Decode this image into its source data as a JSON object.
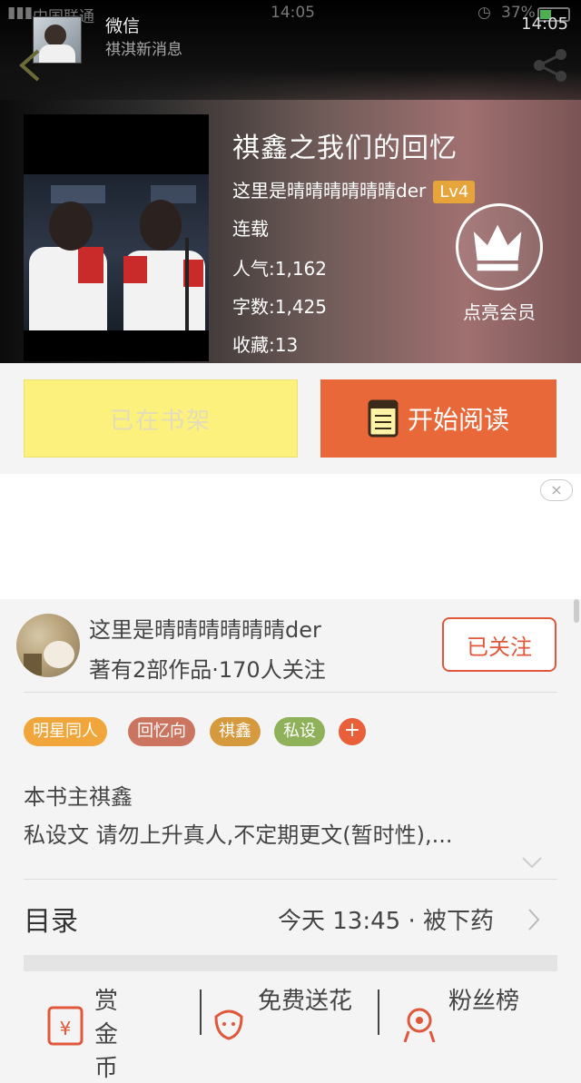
{
  "status_bar": {
    "carrier": "中国联通",
    "time": "14:05",
    "battery": "37%"
  },
  "notification": {
    "app": "微信",
    "message": "祺淇新消息",
    "time": "14:05"
  },
  "book": {
    "title": "祺鑫之我们的回忆",
    "author": "这里是晴晴晴晴晴晴der",
    "author_level": "Lv4",
    "status": "连载",
    "popularity": "人气:1,162",
    "word_count": "字数:1,425",
    "favorites": "收藏:13"
  },
  "vip": {
    "label": "点亮会员",
    "icon": "crown-icon"
  },
  "buttons": {
    "shelf": "已在书架",
    "read": "开始阅读"
  },
  "ad": {
    "close": "×"
  },
  "author_card": {
    "name": "这里是晴晴晴晴晴晴der",
    "stats": "著有2部作品·170人关注",
    "follow": "已关注"
  },
  "tags": [
    {
      "label": "明星同人",
      "color": "#f0a63a"
    },
    {
      "label": "回忆向",
      "color": "#cb7561"
    },
    {
      "label": "祺鑫",
      "color": "#d69a3e"
    },
    {
      "label": "私设",
      "color": "#8fb15a"
    }
  ],
  "tag_add": "+",
  "description": {
    "line1": "本书主祺鑫",
    "line2": "私设文 请勿上升真人,不定期更文(暂时性),..."
  },
  "toc": {
    "label": "目录",
    "latest": "今天 13:45 · 被下药"
  },
  "actions": [
    {
      "label": "赏金币",
      "icon": "red-envelope-icon"
    },
    {
      "label": "免费送花",
      "icon": "flower-icon"
    },
    {
      "label": "粉丝榜",
      "icon": "rank-icon"
    }
  ],
  "colors": {
    "accent": "#e9683a",
    "shelf_button": "#fdf17d",
    "follow": "#e0573b"
  }
}
